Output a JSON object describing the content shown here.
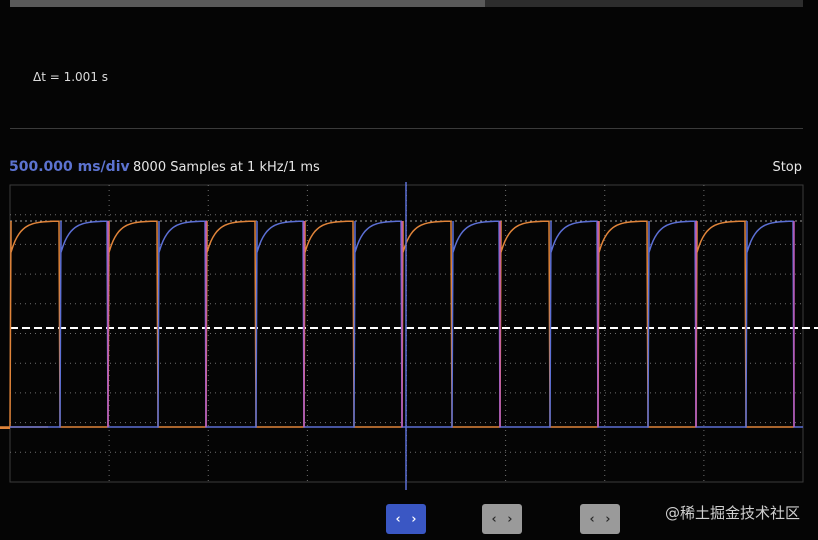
{
  "measurement": {
    "delta_t": "Δt = 1.001 s"
  },
  "timebase": {
    "label": "500.000 ms/div",
    "samples": "8000 Samples at 1 kHz/1 ms",
    "status": "Stop"
  },
  "colors": {
    "orange": "#e0843a",
    "blue": "#5c6fd4",
    "pink": "#c05ab8",
    "grid": "#6f6f6f"
  },
  "navigation": {
    "buttons": [
      {
        "label": "‹ ›",
        "state": "active"
      },
      {
        "label": "‹ ›",
        "state": "inactive"
      },
      {
        "label": "‹ ›",
        "state": "inactive"
      }
    ]
  },
  "watermark": "@稀土掘金技术社区"
}
